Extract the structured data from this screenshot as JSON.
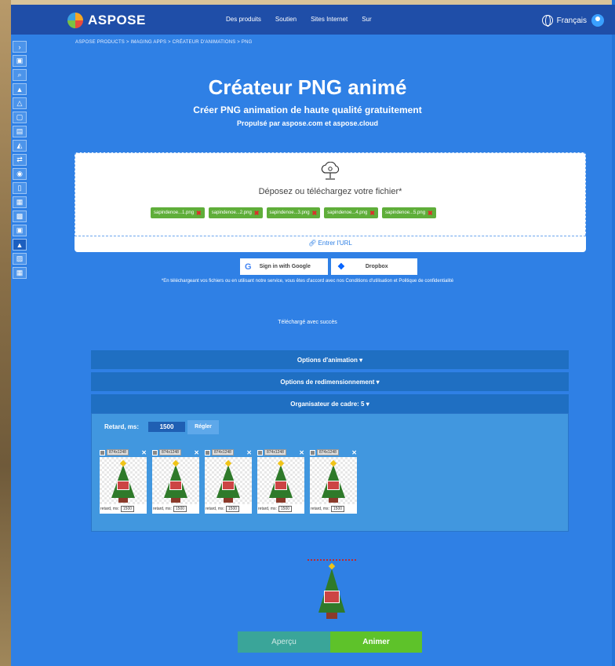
{
  "header": {
    "brand": "ASPOSE",
    "nav": [
      "Des produits",
      "Soutien",
      "Sites Internet",
      "Sur"
    ],
    "language": "Français"
  },
  "breadcrumb": "ASPOSE PRODUCTS > IMAGING APPS > CRÉATEUR D'ANIMATIONS > PNG",
  "hero": {
    "title": "Créateur PNG animé",
    "subtitle": "Créer PNG animation de haute qualité gratuitement",
    "powered": "Propulsé par aspose.com et aspose.cloud"
  },
  "dropzone": {
    "text": "Déposez ou téléchargez votre fichier*",
    "files": [
      "sapindenoe...1.png",
      "sapindenoe...2.png",
      "sapindenoe...3.png",
      "sapindenoe...4.png",
      "sapindenoe...5.png"
    ],
    "url_link": "Entrer l'URL"
  },
  "signin": {
    "google": "Sign in with Google",
    "dropbox": "Dropbox"
  },
  "terms": "*En téléchargeant vos fichiers ou en utilisant notre service, vous êtes d'accord avec nos Conditions d'utilisation et Politique de confidentialité",
  "status": "Téléchargé avec succès",
  "accordions": {
    "animation": "Options d'animation ▾",
    "resize": "Options de redimensionnement ▾",
    "frames": "Organisateur de cadre: 5 ▾"
  },
  "frames_panel": {
    "delay_label": "Retard, ms:",
    "delay_value": "1500",
    "set_button": "Régler",
    "frames": [
      {
        "dim": "874x1248",
        "label": "retard, ms:",
        "value": "1500"
      },
      {
        "dim": "874x1248",
        "label": "retard, ms:",
        "value": "1500"
      },
      {
        "dim": "874x1248",
        "label": "retard, ms:",
        "value": "1500"
      },
      {
        "dim": "874x1248",
        "label": "retard, ms:",
        "value": "1500"
      },
      {
        "dim": "874x1248",
        "label": "retard, ms:",
        "value": "1500"
      }
    ]
  },
  "actions": {
    "preview": "Aperçu",
    "animate": "Animer"
  },
  "colors": {
    "background": "#2f80e5",
    "header": "#1f4ea8",
    "chip": "#5fae3a",
    "animate": "#5ec22a",
    "preview": "#3aa599"
  },
  "toolbar_icons": [
    "chevron-right-icon",
    "image-icon",
    "zoom-image-icon",
    "landscape-icon",
    "mountain-icon",
    "crop-icon",
    "frame-icon",
    "layers-icon",
    "convert-icon",
    "eye-icon",
    "resize-icon",
    "collage-icon",
    "grid-icon",
    "photo-icon",
    "animation-icon",
    "gallery-icon",
    "album-icon"
  ]
}
